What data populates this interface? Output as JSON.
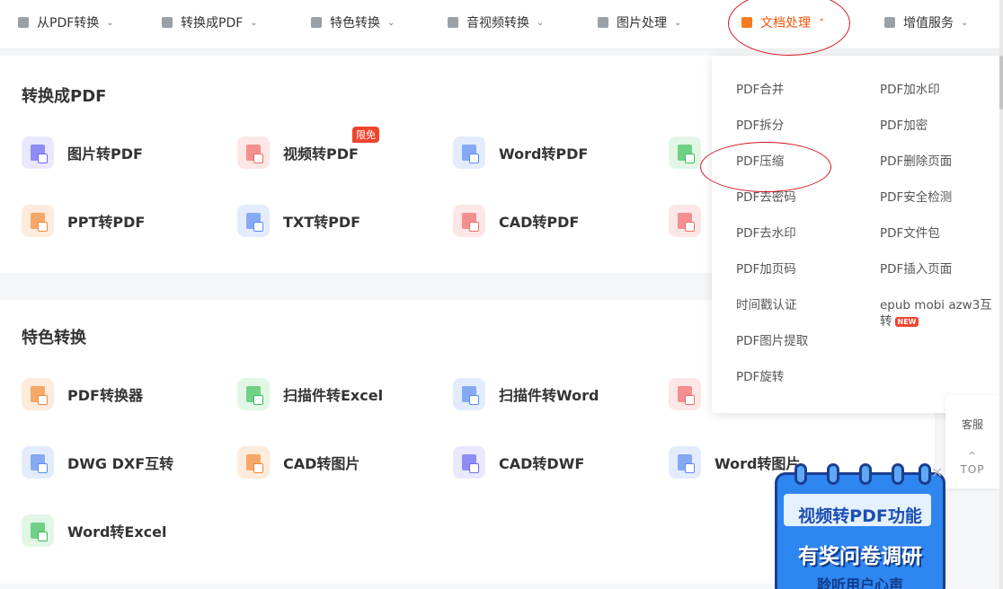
{
  "nav": {
    "items": [
      {
        "label": "从PDF转换",
        "icon": "pdf-icon"
      },
      {
        "label": "转换成PDF",
        "icon": "convert-icon"
      },
      {
        "label": "特色转换",
        "icon": "star-icon"
      },
      {
        "label": "音视频转换",
        "icon": "media-icon"
      },
      {
        "label": "图片处理",
        "icon": "image-icon"
      },
      {
        "label": "文档处理",
        "icon": "document-icon",
        "active": true
      },
      {
        "label": "增值服务",
        "icon": "list-icon"
      }
    ],
    "active_color": "#f0560a"
  },
  "convert_to_pdf": {
    "title": "转换成PDF",
    "tools": [
      {
        "label": "图片转PDF",
        "color": "purple"
      },
      {
        "label": "视频转PDF",
        "color": "red",
        "badge": "限免"
      },
      {
        "label": "Word转PDF",
        "color": "blue"
      },
      {
        "label": "",
        "color": "green"
      },
      {
        "label": "PPT转PDF",
        "color": "orange"
      },
      {
        "label": "TXT转PDF",
        "color": "blue"
      },
      {
        "label": "CAD转PDF",
        "color": "red"
      },
      {
        "label": "",
        "color": "red"
      }
    ]
  },
  "featured": {
    "title": "特色转换",
    "tools": [
      {
        "label": "PDF转换器",
        "color": "orange"
      },
      {
        "label": "扫描件转Excel",
        "color": "green"
      },
      {
        "label": "扫描件转Word",
        "color": "blue"
      },
      {
        "label": "",
        "color": "red"
      },
      {
        "label": "DWG DXF互转",
        "color": "blue"
      },
      {
        "label": "CAD转图片",
        "color": "orange"
      },
      {
        "label": "CAD转DWF",
        "color": "purple"
      },
      {
        "label": "Word转图片",
        "color": "blue"
      },
      {
        "label": "Word转Excel",
        "color": "green"
      }
    ]
  },
  "dropdown": {
    "left": [
      "PDF合并",
      "PDF拆分",
      "PDF压缩",
      "PDF去密码",
      "PDF去水印",
      "PDF加页码",
      "时间戳认证",
      "PDF图片提取",
      "PDF旋转"
    ],
    "right": [
      "PDF加水印",
      "PDF加密",
      "PDF删除页面",
      "PDF安全检测",
      "PDF文件包",
      "PDF插入页面"
    ],
    "right_last_line1": "epub mobi azw3互",
    "right_last_line2": "转",
    "new_badge": "NEW"
  },
  "side": {
    "service": "客服",
    "top": "TOP"
  },
  "promo": {
    "line1": "视频转PDF功能",
    "line2": "有奖问卷调研",
    "line3": "聆听用户心声"
  }
}
